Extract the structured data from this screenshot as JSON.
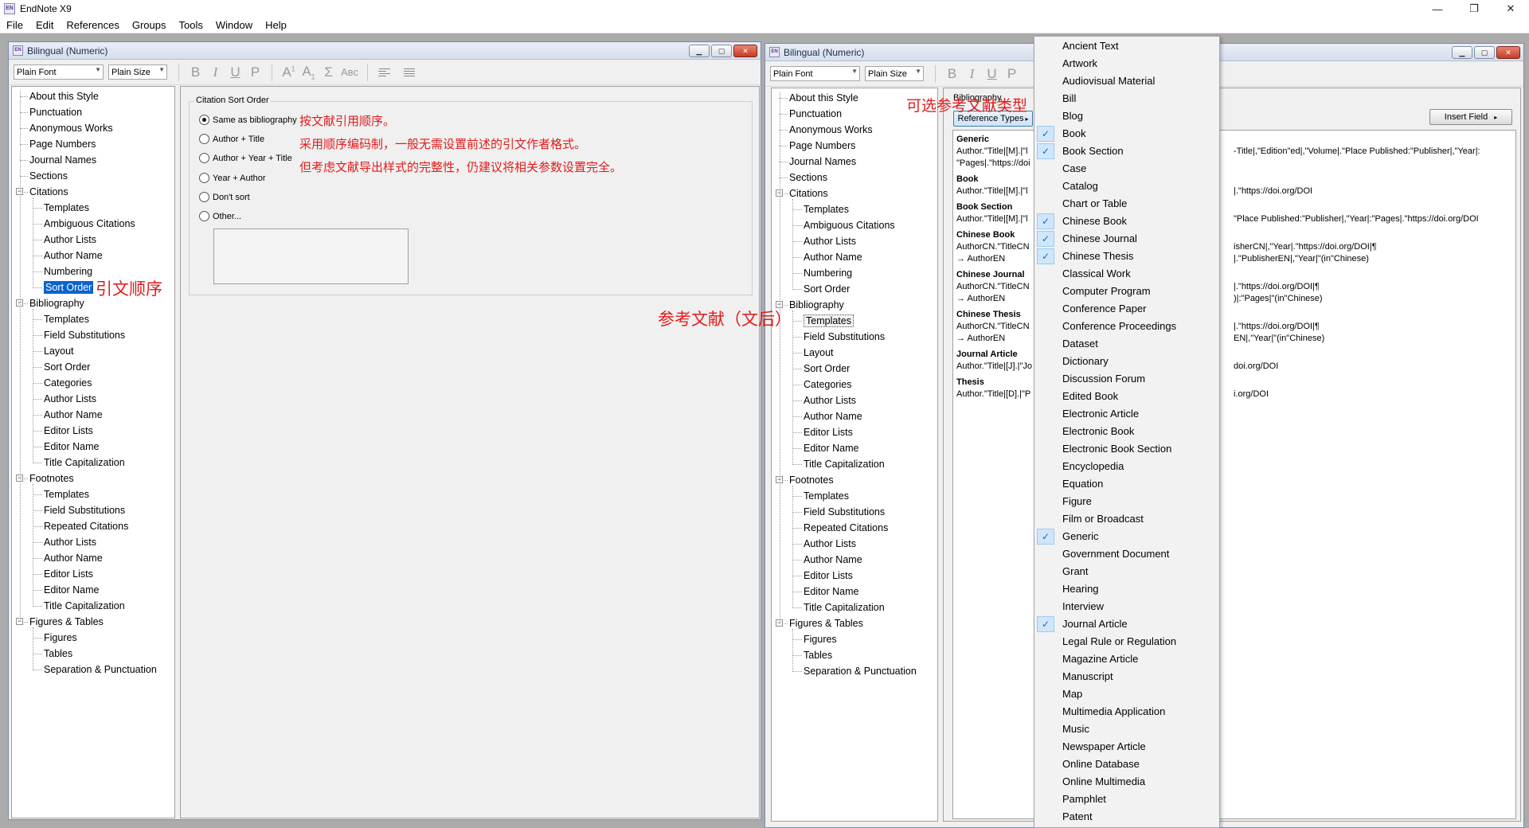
{
  "app": {
    "title": "EndNote X9",
    "icon_text": "EN"
  },
  "window_controls": {
    "minimize": "—",
    "restore": "❐",
    "close": "✕"
  },
  "menu": [
    "File",
    "Edit",
    "References",
    "Groups",
    "Tools",
    "Window",
    "Help"
  ],
  "left_window": {
    "title": "Bilingual (Numeric)",
    "font_combo": "Plain Font",
    "size_combo": "Plain Size",
    "tree": [
      {
        "label": "About this Style",
        "level": 0
      },
      {
        "label": "Punctuation",
        "level": 0
      },
      {
        "label": "Anonymous Works",
        "level": 0
      },
      {
        "label": "Page Numbers",
        "level": 0
      },
      {
        "label": "Journal Names",
        "level": 0
      },
      {
        "label": "Sections",
        "level": 0
      },
      {
        "label": "Citations",
        "level": 0,
        "expand": true
      },
      {
        "label": "Templates",
        "level": 1
      },
      {
        "label": "Ambiguous Citations",
        "level": 1
      },
      {
        "label": "Author Lists",
        "level": 1
      },
      {
        "label": "Author Name",
        "level": 1
      },
      {
        "label": "Numbering",
        "level": 1
      },
      {
        "label": "Sort Order",
        "level": 1,
        "selected": true
      },
      {
        "label": "Bibliography",
        "level": 0,
        "expand": true
      },
      {
        "label": "Templates",
        "level": 1
      },
      {
        "label": "Field Substitutions",
        "level": 1
      },
      {
        "label": "Layout",
        "level": 1
      },
      {
        "label": "Sort Order",
        "level": 1
      },
      {
        "label": "Categories",
        "level": 1
      },
      {
        "label": "Author Lists",
        "level": 1
      },
      {
        "label": "Author Name",
        "level": 1
      },
      {
        "label": "Editor Lists",
        "level": 1
      },
      {
        "label": "Editor Name",
        "level": 1
      },
      {
        "label": "Title Capitalization",
        "level": 1
      },
      {
        "label": "Footnotes",
        "level": 0,
        "expand": true
      },
      {
        "label": "Templates",
        "level": 1
      },
      {
        "label": "Field Substitutions",
        "level": 1
      },
      {
        "label": "Repeated Citations",
        "level": 1
      },
      {
        "label": "Author Lists",
        "level": 1
      },
      {
        "label": "Author Name",
        "level": 1
      },
      {
        "label": "Editor Lists",
        "level": 1
      },
      {
        "label": "Editor Name",
        "level": 1
      },
      {
        "label": "Title Capitalization",
        "level": 1
      },
      {
        "label": "Figures & Tables",
        "level": 0,
        "expand": true
      },
      {
        "label": "Figures",
        "level": 1
      },
      {
        "label": "Tables",
        "level": 1
      },
      {
        "label": "Separation & Punctuation",
        "level": 1
      }
    ],
    "group_label": "Citation Sort Order",
    "radios": [
      {
        "label": "Same as bibliography",
        "checked": true
      },
      {
        "label": "Author + Title",
        "checked": false
      },
      {
        "label": "Author + Year + Title",
        "checked": false
      },
      {
        "label": "Year + Author",
        "checked": false
      },
      {
        "label": "Don't sort",
        "checked": false
      },
      {
        "label": "Other...",
        "checked": false
      }
    ]
  },
  "annotations": {
    "sort_note_1": "按文献引用顺序。",
    "sort_note_2": "采用顺序编码制，一般无需设置前述的引文作者格式。",
    "sort_note_3": "但考虑文献导出样式的完整性，仍建议将相关参数设置完全。",
    "sort_order_label": "引文顺序",
    "bibliography_label": "参考文献（文后）",
    "ref_types_label": "可选参考文献类型"
  },
  "right_window": {
    "title": "Bilingual (Numeric)",
    "font_combo": "Plain Font",
    "size_combo": "Plain Size",
    "selected_item": "Templates",
    "bib_label": "Bibliography",
    "ref_types_button": "Reference Types",
    "insert_field_button": "Insert Field",
    "entries": [
      {
        "type": "Generic",
        "lines": [
          "Author.\"Title|[M].|\"l",
          "\"Pages|.\"https://doi"
        ],
        "tail": [
          "-Title|,\"Edition\"ed|,\"Volume|.\"Place Published:\"Publisher|,\"Year|:",
          ""
        ]
      },
      {
        "type": "Book",
        "lines": [
          "Author.\"Title|[M].|\"l"
        ],
        "tail": [
          "|.\"https://doi.org/DOI"
        ]
      },
      {
        "type": "Book Section",
        "lines": [
          "Author.\"Title|[M].|\"l"
        ],
        "tail": [
          "\"Place Published:\"Publisher|,\"Year|:\"Pages|.\"https://doi.org/DOI"
        ]
      },
      {
        "type": "Chinese Book",
        "lines": [
          "AuthorCN.\"TitleCN",
          "→      AuthorEN"
        ],
        "tail": [
          "isherCN|,\"Year|.\"https://doi.org/DOI|¶",
          "|.\"PublisherEN|,\"Year|\"(in\"Chinese)"
        ]
      },
      {
        "type": "Chinese Journal",
        "lines": [
          "AuthorCN.\"TitleCN",
          "→      AuthorEN"
        ],
        "tail": [
          "|.\"https://doi.org/DOI|¶",
          ")|:\"Pages|\"(in\"Chinese)"
        ]
      },
      {
        "type": "Chinese Thesis",
        "lines": [
          "AuthorCN.\"TitleCN",
          "→      AuthorEN"
        ],
        "tail": [
          "|.\"https://doi.org/DOI|¶",
          "EN|,\"Year|\"(in\"Chinese)"
        ]
      },
      {
        "type": "Journal Article",
        "lines": [
          "Author.\"Title|[J].|\"Jo"
        ],
        "tail": [
          "doi.org/DOI"
        ]
      },
      {
        "type": "Thesis",
        "lines": [
          "Author.\"Title|[D].|\"P"
        ],
        "tail": [
          "i.org/DOI"
        ]
      }
    ]
  },
  "reference_types_menu": [
    {
      "label": "Ancient Text",
      "checked": false
    },
    {
      "label": "Artwork",
      "checked": false
    },
    {
      "label": "Audiovisual Material",
      "checked": false
    },
    {
      "label": "Bill",
      "checked": false
    },
    {
      "label": "Blog",
      "checked": false
    },
    {
      "label": "Book",
      "checked": true
    },
    {
      "label": "Book Section",
      "checked": true
    },
    {
      "label": "Case",
      "checked": false
    },
    {
      "label": "Catalog",
      "checked": false
    },
    {
      "label": "Chart or Table",
      "checked": false
    },
    {
      "label": "Chinese Book",
      "checked": true
    },
    {
      "label": "Chinese Journal",
      "checked": true
    },
    {
      "label": "Chinese Thesis",
      "checked": true
    },
    {
      "label": "Classical Work",
      "checked": false
    },
    {
      "label": "Computer Program",
      "checked": false
    },
    {
      "label": "Conference Paper",
      "checked": false
    },
    {
      "label": "Conference Proceedings",
      "checked": false
    },
    {
      "label": "Dataset",
      "checked": false
    },
    {
      "label": "Dictionary",
      "checked": false
    },
    {
      "label": "Discussion Forum",
      "checked": false
    },
    {
      "label": "Edited Book",
      "checked": false
    },
    {
      "label": "Electronic Article",
      "checked": false
    },
    {
      "label": "Electronic Book",
      "checked": false
    },
    {
      "label": "Electronic Book Section",
      "checked": false
    },
    {
      "label": "Encyclopedia",
      "checked": false
    },
    {
      "label": "Equation",
      "checked": false
    },
    {
      "label": "Figure",
      "checked": false
    },
    {
      "label": "Film or Broadcast",
      "checked": false
    },
    {
      "label": "Generic",
      "checked": true
    },
    {
      "label": "Government Document",
      "checked": false
    },
    {
      "label": "Grant",
      "checked": false
    },
    {
      "label": "Hearing",
      "checked": false
    },
    {
      "label": "Interview",
      "checked": false
    },
    {
      "label": "Journal Article",
      "checked": true
    },
    {
      "label": "Legal Rule or Regulation",
      "checked": false
    },
    {
      "label": "Magazine Article",
      "checked": false
    },
    {
      "label": "Manuscript",
      "checked": false
    },
    {
      "label": "Map",
      "checked": false
    },
    {
      "label": "Multimedia Application",
      "checked": false
    },
    {
      "label": "Music",
      "checked": false
    },
    {
      "label": "Newspaper Article",
      "checked": false
    },
    {
      "label": "Online Database",
      "checked": false
    },
    {
      "label": "Online Multimedia",
      "checked": false
    },
    {
      "label": "Pamphlet",
      "checked": false
    },
    {
      "label": "Patent",
      "checked": false
    }
  ],
  "colors": {
    "accent": "#0a63cf",
    "annotation": "#e31b1b",
    "check_bg": "#cfe6fb"
  },
  "toolbar_icons": [
    "bold-icon",
    "italic-icon",
    "underline-icon",
    "plain-icon",
    "superscript-icon",
    "subscript-icon",
    "symbol-icon",
    "smallcaps-icon",
    "align-left-icon",
    "justify-icon"
  ]
}
